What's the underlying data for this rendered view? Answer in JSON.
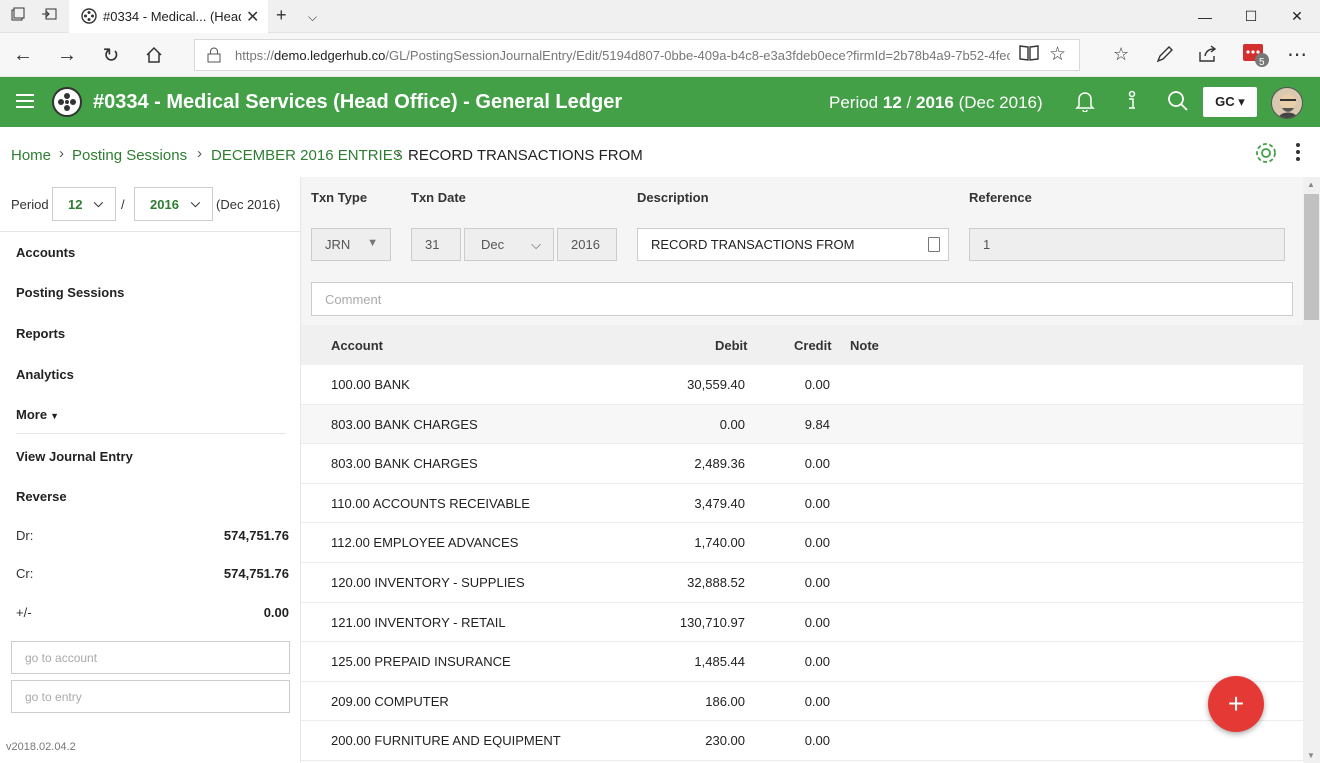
{
  "browser": {
    "tab_title": "#0334 - Medical... (Head",
    "url_prefix": "https://",
    "url_host": "demo.ledgerhub.co",
    "url_path": "/GL/PostingSessionJournalEntry/Edit/5194d807-0bbe-409a-b4c8-e3a3fdeb0ece?firmId=2b78b4a9-7b52-4fec",
    "extension_badge": "5",
    "minimize": "—",
    "maximize": "☐",
    "close": "✕"
  },
  "header": {
    "title": "#0334 - Medical Services (Head Office) - General Ledger",
    "period_label": "Period",
    "period_month": "12",
    "period_sep": "/",
    "period_year": "2016",
    "period_desc": "(Dec 2016)",
    "user_button": "GC ▾",
    "accent_color": "#43a047"
  },
  "breadcrumb": {
    "items": [
      "Home",
      "Posting Sessions",
      "DECEMBER 2016 ENTRIES"
    ],
    "current": "RECORD TRANSACTIONS FROM",
    "separator": "›"
  },
  "sidebar": {
    "period_label": "Period",
    "month": "12",
    "slash": "/",
    "year": "2016",
    "period_desc": "(Dec 2016)",
    "nav": [
      "Accounts",
      "Posting Sessions",
      "Reports",
      "Analytics",
      "More"
    ],
    "actions": [
      "View Journal Entry",
      "Reverse"
    ],
    "stats": [
      {
        "label": "Dr:",
        "value": "574,751.76"
      },
      {
        "label": "Cr:",
        "value": "574,751.76"
      },
      {
        "label": "+/-",
        "value": "0.00"
      }
    ],
    "go_account_placeholder": "go to account",
    "go_entry_placeholder": "go to entry",
    "version": "v2018.02.04.2"
  },
  "form": {
    "txn_type_label": "Txn Type",
    "txn_type_value": "JRN",
    "txn_date_label": "Txn Date",
    "day": "31",
    "month": "Dec",
    "year": "2016",
    "description_label": "Description",
    "description_value": "RECORD TRANSACTIONS FROM",
    "reference_label": "Reference",
    "reference_value": "1",
    "comment_placeholder": "Comment"
  },
  "table": {
    "headers": {
      "account": "Account",
      "debit": "Debit",
      "credit": "Credit",
      "note": "Note"
    },
    "rows": [
      {
        "account": "100.00 BANK",
        "debit": "30,559.40",
        "credit": "0.00"
      },
      {
        "account": "803.00 BANK CHARGES",
        "debit": "0.00",
        "credit": "9.84"
      },
      {
        "account": "803.00 BANK CHARGES",
        "debit": "2,489.36",
        "credit": "0.00"
      },
      {
        "account": "110.00 ACCOUNTS RECEIVABLE",
        "debit": "3,479.40",
        "credit": "0.00"
      },
      {
        "account": "112.00 EMPLOYEE ADVANCES",
        "debit": "1,740.00",
        "credit": "0.00"
      },
      {
        "account": "120.00 INVENTORY - SUPPLIES",
        "debit": "32,888.52",
        "credit": "0.00"
      },
      {
        "account": "121.00 INVENTORY - RETAIL",
        "debit": "130,710.97",
        "credit": "0.00"
      },
      {
        "account": "125.00 PREPAID INSURANCE",
        "debit": "1,485.44",
        "credit": "0.00"
      },
      {
        "account": "209.00 COMPUTER",
        "debit": "186.00",
        "credit": "0.00"
      },
      {
        "account": "200.00 FURNITURE AND EQUIPMENT",
        "debit": "230.00",
        "credit": "0.00"
      }
    ]
  },
  "fab": {
    "label": "+",
    "color": "#e53935"
  }
}
